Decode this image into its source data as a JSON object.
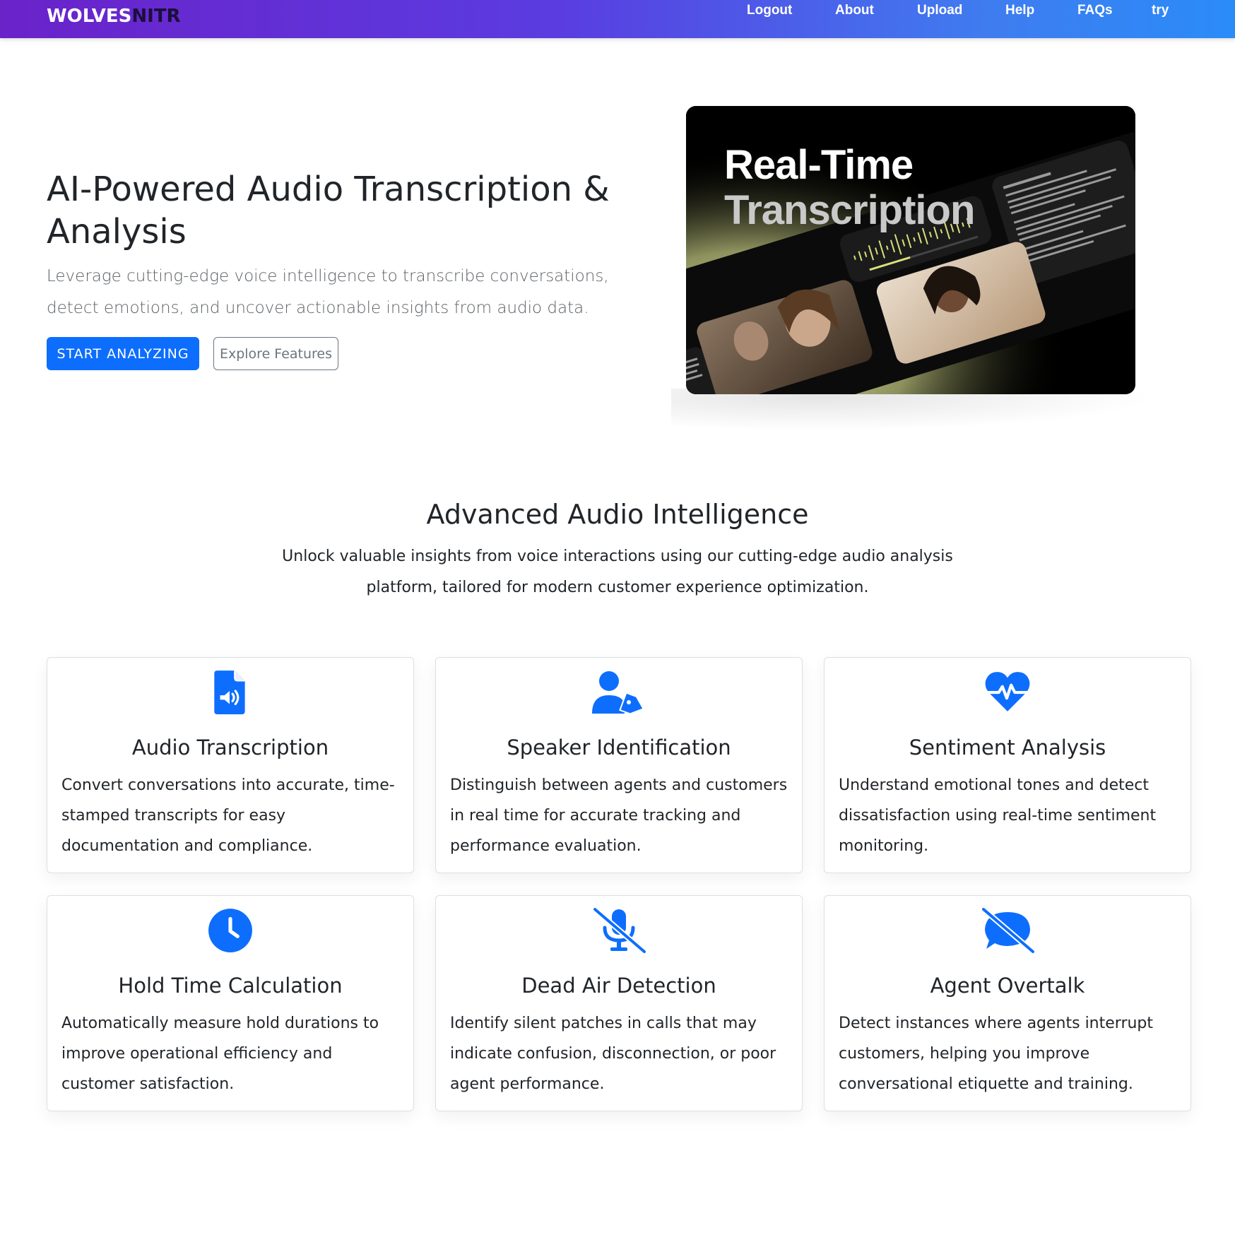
{
  "navbar": {
    "brand_part1": "WOLVES",
    "brand_part2": "NITR",
    "links": [
      "Logout",
      "About",
      "Upload",
      "Help",
      "FAQs",
      "try"
    ]
  },
  "hero": {
    "title": "AI-Powered Audio Transcription & Analysis",
    "subtitle": "Leverage cutting-edge voice intelligence to transcribe conversations, detect emotions, and uncover actionable insights from audio data.",
    "primary_button": "START ANALYZING",
    "secondary_button": "Explore Features",
    "image": {
      "title_line1": "Real-Time",
      "title_line2": "Transcription"
    }
  },
  "features": {
    "title": "Advanced Audio Intelligence",
    "subtitle": "Unlock valuable insights from voice interactions using our cutting-edge audio analysis platform, tailored for modern customer experience optimization.",
    "icon_color": "#0d6efd",
    "cards": [
      {
        "icon": "file-audio-icon",
        "title": "Audio Transcription",
        "description": "Convert conversations into accurate, time-stamped transcripts for easy documentation and compliance."
      },
      {
        "icon": "user-tag-icon",
        "title": "Speaker Identification",
        "description": "Distinguish between agents and customers in real time for accurate tracking and performance evaluation."
      },
      {
        "icon": "heart-pulse-icon",
        "title": "Sentiment Analysis",
        "description": "Understand emotional tones and detect dissatisfaction using real-time sentiment monitoring."
      },
      {
        "icon": "clock-icon",
        "title": "Hold Time Calculation",
        "description": "Automatically measure hold durations to improve operational efficiency and customer satisfaction."
      },
      {
        "icon": "microphone-slash-icon",
        "title": "Dead Air Detection",
        "description": "Identify silent patches in calls that may indicate confusion, disconnection, or poor agent performance."
      },
      {
        "icon": "comment-slash-icon",
        "title": "Agent Overtalk",
        "description": "Detect instances where agents interrupt customers, helping you improve conversational etiquette and training."
      }
    ]
  }
}
